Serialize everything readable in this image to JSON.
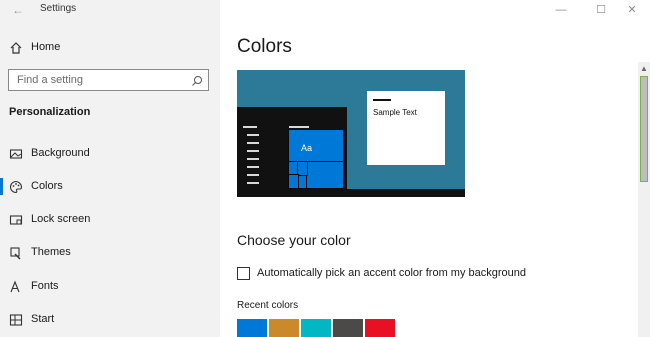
{
  "window": {
    "title": "Settings",
    "controls": {
      "minimize_icon": "minimize-icon",
      "maximize_icon": "maximize-icon",
      "close_icon": "close-icon"
    }
  },
  "sidebar": {
    "home": {
      "label": "Home",
      "icon": "home-icon"
    },
    "search": {
      "placeholder": "Find a setting",
      "icon": "search-icon"
    },
    "section": "Personalization",
    "items": [
      {
        "label": "Background",
        "icon": "picture-icon",
        "active": false
      },
      {
        "label": "Colors",
        "icon": "palette-icon",
        "active": true
      },
      {
        "label": "Lock screen",
        "icon": "lock-screen-icon",
        "active": false
      },
      {
        "label": "Themes",
        "icon": "brush-icon",
        "active": false
      },
      {
        "label": "Fonts",
        "icon": "font-icon",
        "active": false
      },
      {
        "label": "Start",
        "icon": "start-icon",
        "active": false
      }
    ]
  },
  "main": {
    "title": "Colors",
    "preview": {
      "sample_text": "Sample Text",
      "tile_text": "Aa"
    },
    "choose_heading": "Choose your color",
    "auto_accent": {
      "label": "Automatically pick an accent color from my background",
      "checked": false
    },
    "recent_label": "Recent colors",
    "recent_colors": [
      "#0078d7",
      "#ca8a2a",
      "#00b7c3",
      "#4c4a48",
      "#e81123"
    ]
  },
  "colors": {
    "accent": "#0078d7",
    "preview_background": "#2c7a97",
    "scrollbar_focus": "#7ab14a"
  }
}
